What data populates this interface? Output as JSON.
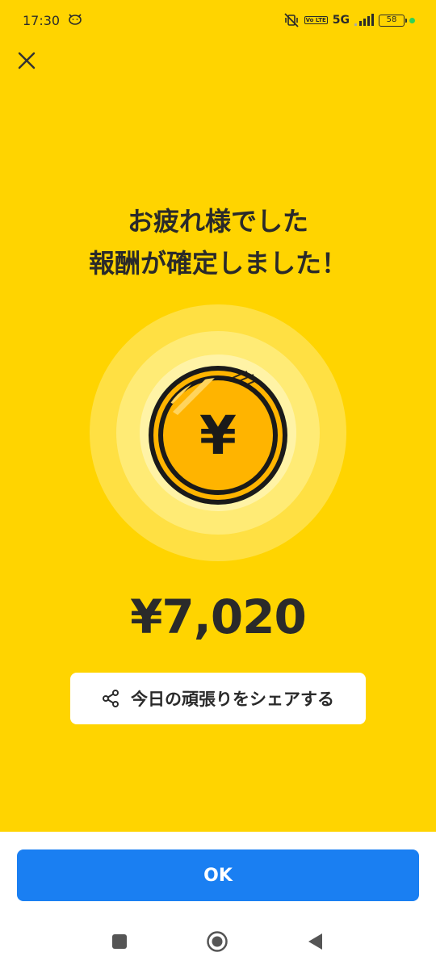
{
  "status_bar": {
    "time": "17:30",
    "network": "5G",
    "volte": "Vo LTE",
    "battery": "58"
  },
  "title": {
    "line1": "お疲れ様でした",
    "line2": "報酬が確定しました！"
  },
  "coin": {
    "symbol": "¥"
  },
  "amount": "¥7,020",
  "share_button": {
    "label": "今日の頑張りをシェアする"
  },
  "ok_button": {
    "label": "OK"
  },
  "colors": {
    "background": "#FFD400",
    "coin_fill": "#FFB400",
    "primary_button": "#1A7FF2",
    "text": "#2a2a2a"
  },
  "icons": [
    "cat-face-icon",
    "mute-vibrate-icon",
    "signal-icon",
    "battery-icon",
    "close-icon",
    "yen-coin-icon",
    "share-icon",
    "nav-recent-icon",
    "nav-home-icon",
    "nav-back-icon"
  ]
}
